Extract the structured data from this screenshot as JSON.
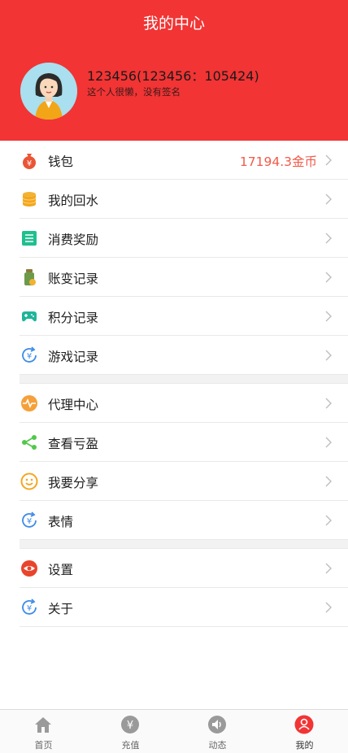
{
  "header": {
    "title": "我的中心",
    "username": "123456(123456：105424)",
    "signature": "这个人很懒，没有签名"
  },
  "menu": {
    "group1": [
      {
        "label": "钱包",
        "value": "17194.3金币",
        "icon": "money-bag-icon"
      },
      {
        "label": "我的回水",
        "icon": "coins-stack-icon"
      },
      {
        "label": "消费奖励",
        "icon": "document-list-icon"
      },
      {
        "label": "账变记录",
        "icon": "jar-icon"
      },
      {
        "label": "积分记录",
        "icon": "gamepad-icon"
      },
      {
        "label": "游戏记录",
        "icon": "yen-refresh-icon"
      }
    ],
    "group2": [
      {
        "label": "代理中心",
        "icon": "pulse-icon"
      },
      {
        "label": "查看亏盈",
        "icon": "share-nodes-icon"
      },
      {
        "label": "我要分享",
        "icon": "smiley-icon"
      },
      {
        "label": "表情",
        "icon": "yen-refresh-icon"
      }
    ],
    "group3": [
      {
        "label": "设置",
        "icon": "settings-icon"
      },
      {
        "label": "关于",
        "icon": "yen-refresh-icon"
      }
    ]
  },
  "tabbar": [
    {
      "label": "首页",
      "icon": "home-icon"
    },
    {
      "label": "充值",
      "icon": "yen-circle-icon"
    },
    {
      "label": "动态",
      "icon": "speaker-icon"
    },
    {
      "label": "我的",
      "icon": "user-icon",
      "active": true
    }
  ],
  "colors": {
    "accent": "#f23434",
    "balance": "#f25a4a"
  }
}
